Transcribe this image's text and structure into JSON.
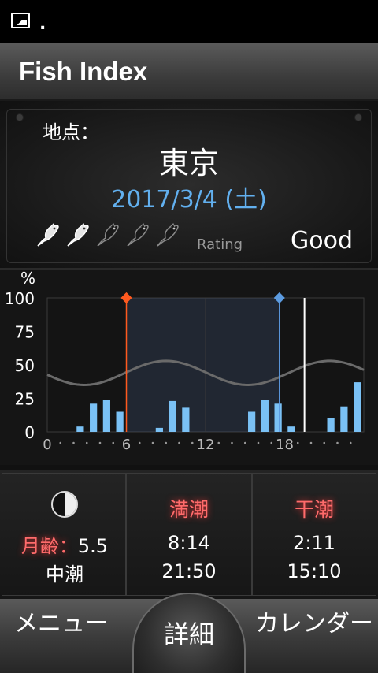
{
  "status": {
    "indicator": "."
  },
  "app": {
    "title": "Fish Index"
  },
  "location": {
    "label": "地点：",
    "city": "東京",
    "date": "2017/3/4 (土)"
  },
  "rating": {
    "label": "Rating",
    "value": "Good",
    "filled": 2,
    "total": 5
  },
  "chart_data": {
    "type": "bar",
    "ylabel": "%",
    "ylim": [
      0,
      100
    ],
    "yticks": [
      "0",
      "25",
      "50",
      "75",
      "100"
    ],
    "xlim": [
      0,
      24
    ],
    "xticks": [
      "0",
      "6",
      "12",
      "18"
    ],
    "hours": [
      1,
      2,
      3,
      4,
      5,
      6,
      7,
      8,
      9,
      10,
      11,
      12,
      13,
      14,
      15,
      16,
      17,
      18,
      19,
      20,
      21,
      22,
      23,
      24
    ],
    "values": [
      0,
      0,
      4,
      21,
      24,
      15,
      0,
      0,
      3,
      23,
      18,
      0,
      0,
      0,
      0,
      15,
      24,
      21,
      4,
      0,
      0,
      10,
      19,
      37
    ],
    "tide_curve": {
      "mean": 44,
      "amplitude": 9,
      "peak_hour": 9
    },
    "markers": [
      {
        "hour": 6,
        "color": "#ff5a1f"
      },
      {
        "hour": 17.6,
        "color": "#5c9be0"
      }
    ],
    "current_hour": 19.5,
    "shaded_range": [
      6,
      17.6
    ],
    "colors": {
      "bars": "#7ac1f5",
      "curve": "#6a6a6a",
      "grid": "#3a3a3a"
    }
  },
  "moon": {
    "label": "月齢：",
    "age": "5.5",
    "tide_type": "中潮"
  },
  "high_tide": {
    "label": "満潮",
    "times": [
      "8:14",
      "21:50"
    ]
  },
  "low_tide": {
    "label": "干潮",
    "times": [
      "2:11",
      "15:10"
    ]
  },
  "nav": {
    "menu": "メニュー",
    "detail": "詳細",
    "calendar": "カレンダー"
  }
}
